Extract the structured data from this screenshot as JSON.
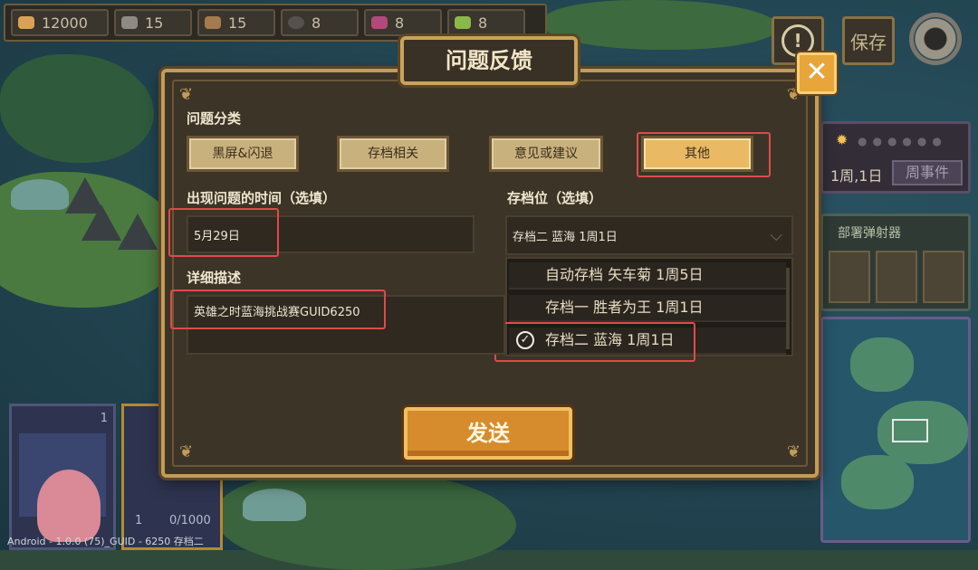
{
  "resources": [
    {
      "name": "gold",
      "value": "12000",
      "icon": "gold-pile-icon",
      "color": "#d9a25a"
    },
    {
      "name": "ore",
      "value": "15",
      "icon": "stone-icon",
      "color": "#8e8a84"
    },
    {
      "name": "wood",
      "value": "15",
      "icon": "wood-log-icon",
      "color": "#a57a4c"
    },
    {
      "name": "bomb",
      "value": "8",
      "icon": "bomb-icon",
      "color": "#55524e"
    },
    {
      "name": "crystal",
      "value": "8",
      "icon": "crystal-icon",
      "color": "#b04a7a"
    },
    {
      "name": "herb",
      "value": "8",
      "icon": "herb-icon",
      "color": "#8bb84a"
    }
  ],
  "top_right": {
    "alert_icon": "exclamation-icon",
    "save_label": "保存",
    "settings_icon": "gear-icon"
  },
  "right_panel": {
    "week_label": "1周,1日",
    "week_event_label": "周事件",
    "deploy_label": "部署弹射器"
  },
  "left_card": {
    "count": "1"
  },
  "left_card2": {
    "count": "1",
    "capacity": "0/1000"
  },
  "footer": {
    "version_text": "Android - 1.0.0 (75)_GUID - 6250   存档二"
  },
  "dialog": {
    "title": "问题反馈",
    "close_label": "✕",
    "category_label": "问题分类",
    "categories": [
      "黑屏&闪退",
      "存档相关",
      "意见或建议",
      "其他"
    ],
    "selected_category": "其他",
    "time_label": "出现问题的时间（选填）",
    "time_value": "5月29日",
    "slot_label": "存档位（选填）",
    "slot_selected": "存档二 蓝海 1周1日",
    "slot_options": [
      "自动存档 矢车菊 1周5日",
      "存档一 胜者为王 1周1日",
      "存档二 蓝海 1周1日"
    ],
    "detail_label": "详细描述",
    "detail_value": "英雄之时蓝海挑战赛GUID6250",
    "send_label": "发送"
  },
  "colors": {
    "highlight": "#e04a4a",
    "accent_gold": "#c29c58",
    "send_orange": "#d68b2c"
  }
}
